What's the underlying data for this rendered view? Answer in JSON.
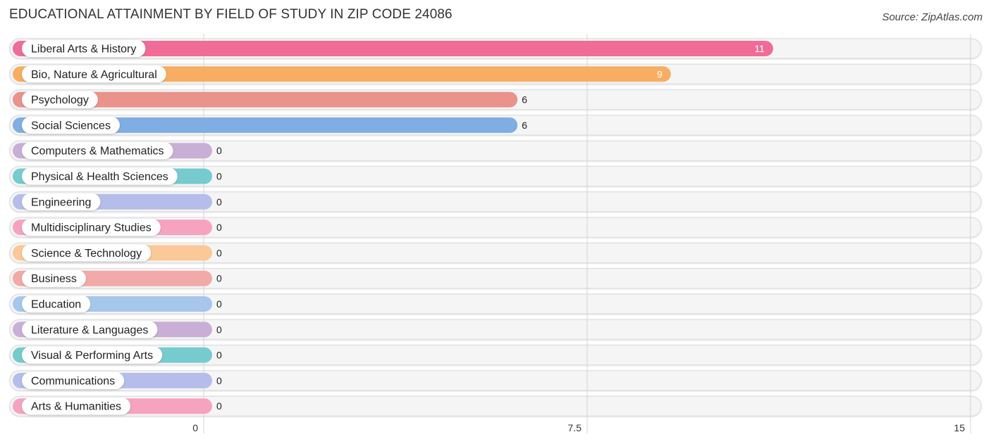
{
  "header": {
    "title": "EDUCATIONAL ATTAINMENT BY FIELD OF STUDY IN ZIP CODE 24086",
    "source": "Source: ZipAtlas.com"
  },
  "chart_data": {
    "type": "bar",
    "orientation": "horizontal",
    "title": "EDUCATIONAL ATTAINMENT BY FIELD OF STUDY IN ZIP CODE 24086",
    "xlabel": "",
    "ylabel": "",
    "xlim": [
      0,
      15
    ],
    "xticks": [
      {
        "value": 0,
        "label": "0"
      },
      {
        "value": 7.5,
        "label": "7.5"
      },
      {
        "value": 15,
        "label": "15"
      }
    ],
    "grid": true,
    "legend": "none",
    "categories": [
      "Liberal Arts & History",
      "Bio, Nature & Agricultural",
      "Psychology",
      "Social Sciences",
      "Computers & Mathematics",
      "Physical & Health Sciences",
      "Engineering",
      "Multidisciplinary Studies",
      "Science & Technology",
      "Business",
      "Education",
      "Literature & Languages",
      "Visual & Performing Arts",
      "Communications",
      "Arts & Humanities"
    ],
    "values": [
      11,
      9,
      6,
      6,
      0,
      0,
      0,
      0,
      0,
      0,
      0,
      0,
      0,
      0,
      0
    ],
    "value_labels": [
      "11",
      "9",
      "6",
      "6",
      "0",
      "0",
      "0",
      "0",
      "0",
      "0",
      "0",
      "0",
      "0",
      "0",
      "0"
    ],
    "colors": [
      "#f06b96",
      "#f7ae63",
      "#ea928c",
      "#7eaee3",
      "#c9afd6",
      "#76cbcf",
      "#b5bdeb",
      "#f6a3c0",
      "#fbc897",
      "#f1aaa7",
      "#a6c6ec",
      "#c9afd6",
      "#76cbcf",
      "#b5bdeb",
      "#f6a3c0"
    ]
  }
}
